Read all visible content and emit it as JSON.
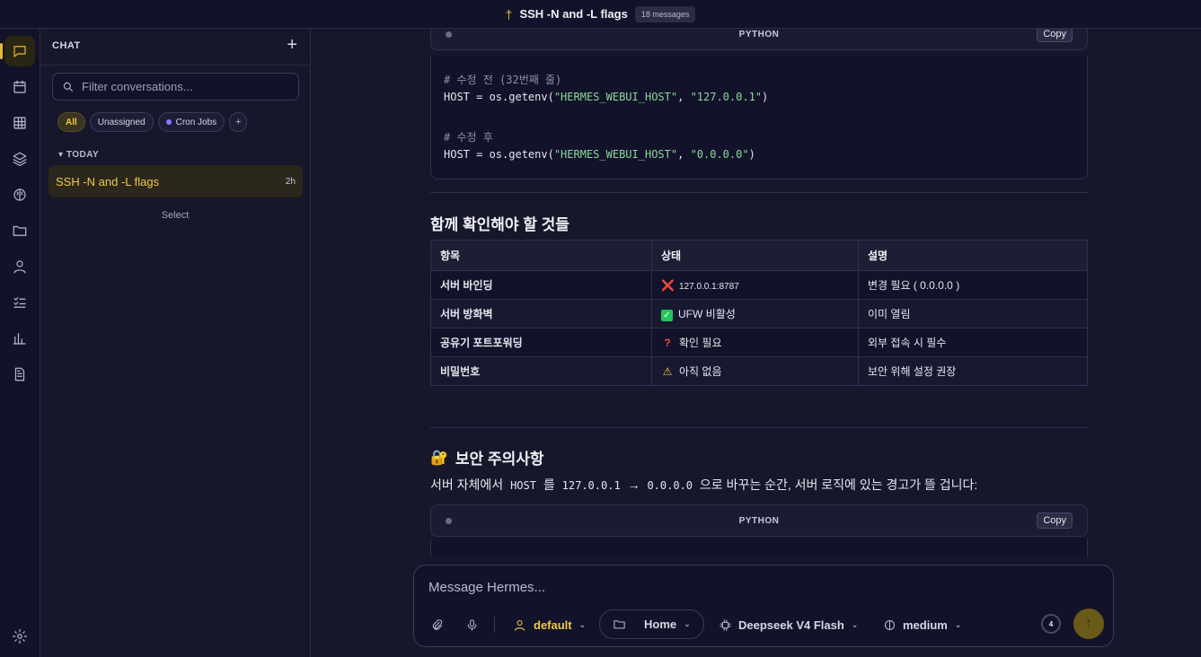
{
  "topbar": {
    "pin_icon": "pin-icon",
    "title": "SSH -N and -L flags",
    "messages_badge": "18 messages"
  },
  "rail": {
    "items": [
      "chat-icon",
      "calendar-icon",
      "grid-icon",
      "layers-icon",
      "brain-icon",
      "folder-icon",
      "user-icon",
      "checklist-icon",
      "bar-chart-icon",
      "document-icon"
    ],
    "settings": "gear-icon"
  },
  "sidebar": {
    "heading": "CHAT",
    "add": "+",
    "filter_placeholder": "Filter conversations...",
    "chips": {
      "all": "All",
      "unassigned": "Unassigned",
      "cron": "Cron Jobs",
      "add": "+"
    },
    "group": "TODAY",
    "conversation": {
      "title": "SSH -N and -L flags",
      "time": "2h"
    },
    "select_label": "Select"
  },
  "code1": {
    "lang": "PYTHON",
    "copy": "Copy",
    "lines": {
      "c1": "# 수정 전 (32번째 줄)",
      "l1a": "HOST = os.getenv(",
      "l1b": "\"HERMES_WEBUI_HOST\"",
      "l1c": ", ",
      "l1d": "\"127.0.0.1\"",
      "l1e": ")",
      "c2": "# 수정 후",
      "l2a": "HOST = os.getenv(",
      "l2b": "\"HERMES_WEBUI_HOST\"",
      "l2c": ", ",
      "l2d": "\"0.0.0.0\"",
      "l2e": ")"
    }
  },
  "check": {
    "heading": "함께 확인해야 할 것들",
    "headers": [
      "항목",
      "상태",
      "설명"
    ],
    "rows": [
      {
        "item": "서버 바인딩",
        "icon": "❌",
        "status": "127.0.0.1:8787",
        "desc": "변경 필요 ( 0.0.0.0 )"
      },
      {
        "item": "서버 방화벽",
        "icon": "✅",
        "status": "UFW 비활성",
        "desc": "이미 열림"
      },
      {
        "item": "공유기 포트포워딩",
        "icon": "❓",
        "status": "확인 필요",
        "desc": "외부 접속 시 필수"
      },
      {
        "item": "비밀번호",
        "icon": "⚠",
        "status": "아직 없음",
        "desc": "보안 위해 설정 권장"
      }
    ]
  },
  "security": {
    "icon": "🔐",
    "heading": "보안 주의사항",
    "p1": "서버 자체에서",
    "c1": "HOST",
    "p2": "를",
    "c2": "127.0.0.1",
    "arrow": "→",
    "c3": "0.0.0.0",
    "p3": "으로 바꾸는 순간, 서버 로직에 있는 경고가 뜰 겁니다:"
  },
  "code2": {
    "lang": "PYTHON",
    "copy": "Copy"
  },
  "composer": {
    "placeholder": "Message Hermes...",
    "profile": "default",
    "workspace": "Home",
    "model": "Deepseek V4 Flash",
    "effort": "medium",
    "context_count": "4"
  },
  "colors": {
    "accent": "#e8b931",
    "bg": "#16172b",
    "panel": "#12132a"
  }
}
